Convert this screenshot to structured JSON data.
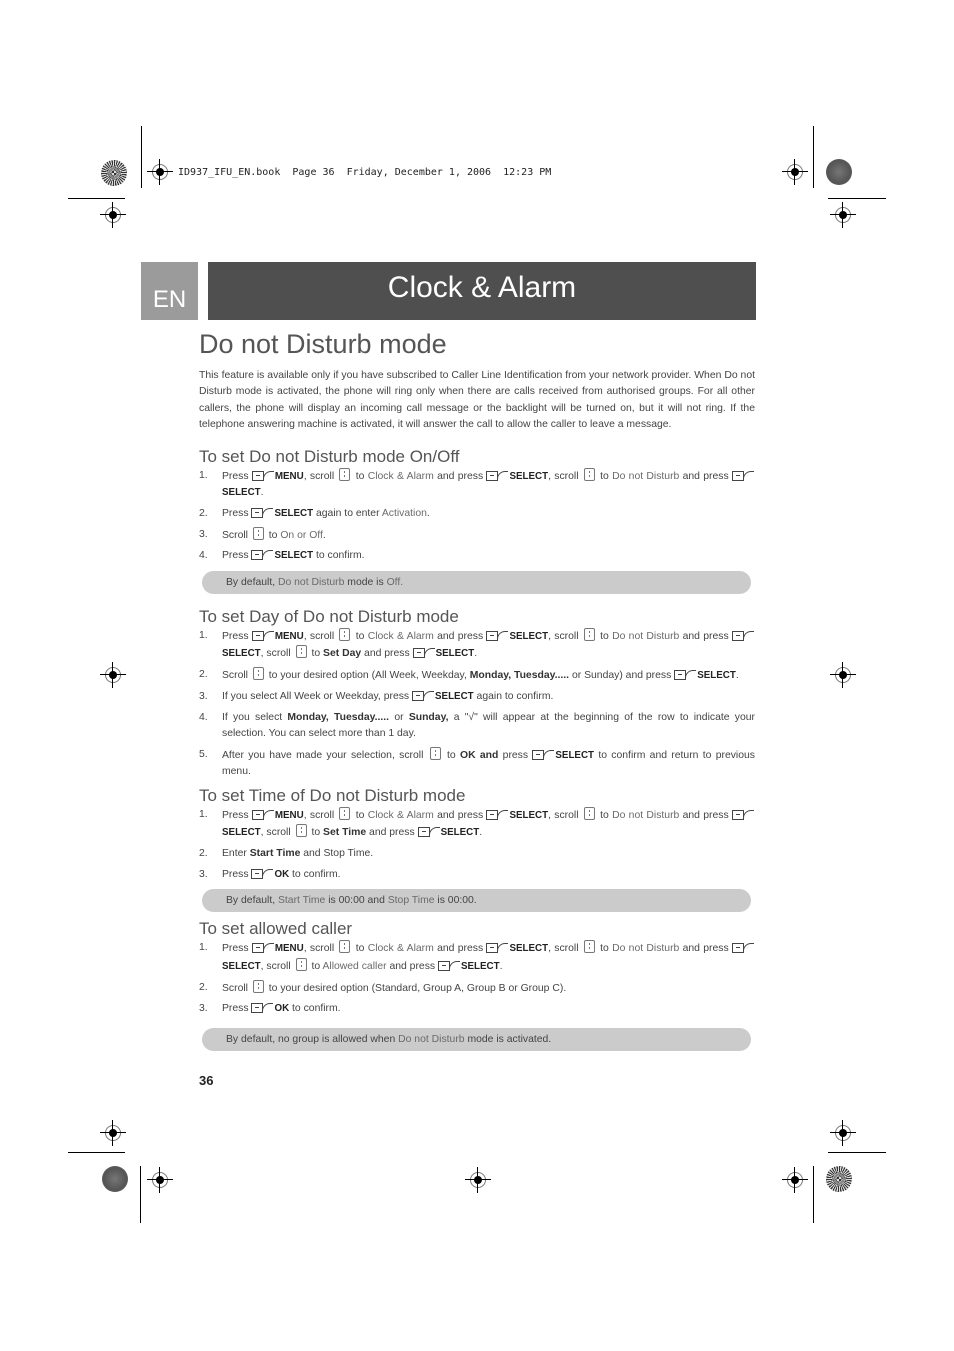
{
  "print_header": "ID937_IFU_EN.book  Page 36  Friday, December 1, 2006  12:23 PM",
  "language_tab": "EN",
  "chapter_title": "Clock & Alarm",
  "section_title": "Do not Disturb mode",
  "intro": "This feature is available only if you have subscribed to Caller Line Identification from your network provider. When Do not Disturb mode is activated, the phone will ring only when there are calls received from authorised groups. For all other callers, the phone will display an incoming call message or the backlight will be turned on, but it will not ring. If the telephone answering machine is activated, it will answer the call to allow the caller to leave a message.",
  "icons": {
    "softkey": "softkey-button-icon",
    "scroll": "scroll-key-icon"
  },
  "terms": {
    "menu": "MENU",
    "select": "SELECT",
    "ok": "OK",
    "clock_alarm": "Clock & Alarm",
    "dnd": "Do not Disturb"
  },
  "sections": [
    {
      "heading": "To set Do not Disturb mode On/Off",
      "steps": [
        {
          "num": "1.",
          "text": "Press MENU, scroll to Clock & Alarm and press SELECT, scroll to Do not Disturb and press SELECT."
        },
        {
          "num": "2.",
          "text": "Press SELECT again to enter Activation."
        },
        {
          "num": "3.",
          "text": "Scroll to On or Off."
        },
        {
          "num": "4.",
          "text": "Press SELECT to confirm."
        }
      ],
      "note": "By default, Do not Disturb mode is Off."
    },
    {
      "heading": "To set Day of Do not Disturb mode",
      "steps": [
        {
          "num": "1.",
          "text": "Press MENU, scroll to Clock & Alarm and press SELECT, scroll to Do not Disturb and press SELECT, scroll to Set Day and press SELECT."
        },
        {
          "num": "2.",
          "text": "Scroll to your desired option (All Week, Weekday, Monday, Tuesday..... or Sunday) and press SELECT."
        },
        {
          "num": "3.",
          "text": "If you select All Week or Weekday, press SELECT again to confirm."
        },
        {
          "num": "4.",
          "text": "If you select Monday, Tuesday..... or Sunday, a \"√\" will appear at the beginning of the row to indicate your selection. You can select more than 1 day."
        },
        {
          "num": "5.",
          "text": "After you have made your selection, scroll to OK and press SELECT to confirm and return to previous menu."
        }
      ]
    },
    {
      "heading": "To set Time of Do not Disturb mode",
      "steps": [
        {
          "num": "1.",
          "text": "Press MENU, scroll to Clock & Alarm and press SELECT, scroll to Do not Disturb and press SELECT, scroll to Set Time and press SELECT."
        },
        {
          "num": "2.",
          "text": "Enter Start Time and Stop Time."
        },
        {
          "num": "3.",
          "text": "Press OK to confirm."
        }
      ],
      "note": "By default, Start Time is 00:00 and Stop Time is 00:00."
    },
    {
      "heading": "To set allowed caller",
      "steps": [
        {
          "num": "1.",
          "text": "Press MENU, scroll to Clock & Alarm and press SELECT, scroll to Do not Disturb and press SELECT, scroll to Allowed caller and press SELECT."
        },
        {
          "num": "2.",
          "text": "Scroll to your desired option (Standard, Group A, Group B or Group C)."
        },
        {
          "num": "3.",
          "text": "Press OK to confirm."
        }
      ],
      "note": "By default, no group is allowed when Do not Disturb mode is activated."
    }
  ],
  "page_number": "36"
}
